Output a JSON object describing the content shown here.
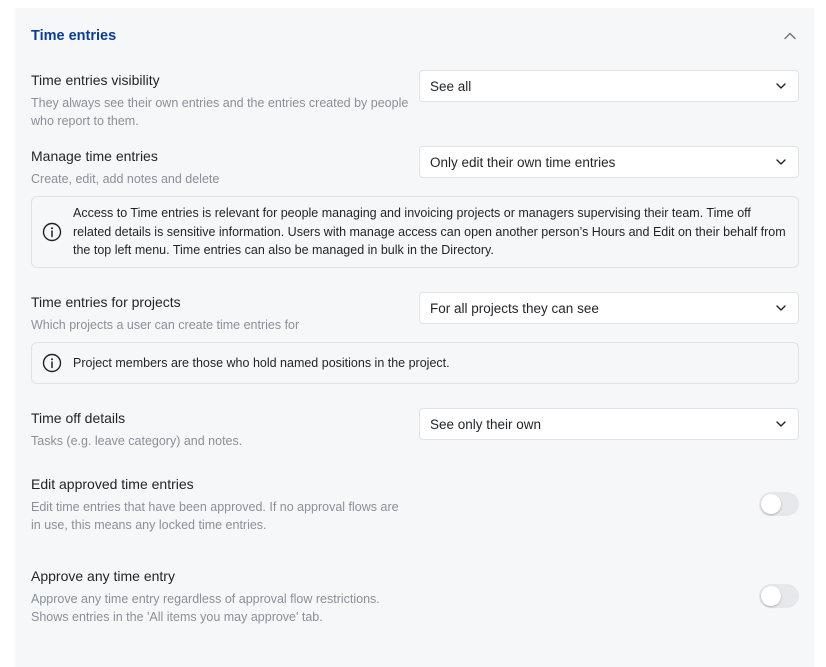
{
  "section": {
    "title": "Time entries"
  },
  "visibility": {
    "label": "Time entries visibility",
    "description": "They always see their own entries and the entries created by people who report to them.",
    "value": "See all"
  },
  "manage": {
    "label": "Manage time entries",
    "description": "Create, edit, add notes and delete",
    "value": "Only edit their own time entries",
    "info": "Access to Time entries is relevant for people managing and invoicing projects or managers supervising their team. Time off related details is sensitive information. Users with manage access can open another person’s Hours and Edit on their behalf from the top left menu. Time entries can also be managed in bulk in the Directory."
  },
  "projects": {
    "label": "Time entries for projects",
    "description": "Which projects a user can create time entries for",
    "value": "For all projects they can see",
    "info": "Project members are those who hold named positions in the project."
  },
  "timeoff": {
    "label": "Time off details",
    "description": "Tasks (e.g. leave category) and notes.",
    "value": "See only their own"
  },
  "edit_approved": {
    "label": "Edit approved time entries",
    "description": "Edit time entries that have been approved. If no approval flows are in use, this means any locked time entries.",
    "enabled": false
  },
  "approve_any": {
    "label": "Approve any time entry",
    "description": "Approve any time entry regardless of approval flow restrictions. Shows entries in the 'All items you may approve' tab.",
    "enabled": false
  },
  "colors": {
    "title": "#0b3d91",
    "panel_bg": "#f6f7f9",
    "muted_text": "#8a9099",
    "border": "#dfe2e6",
    "toggle_off": "#e6e8eb"
  }
}
